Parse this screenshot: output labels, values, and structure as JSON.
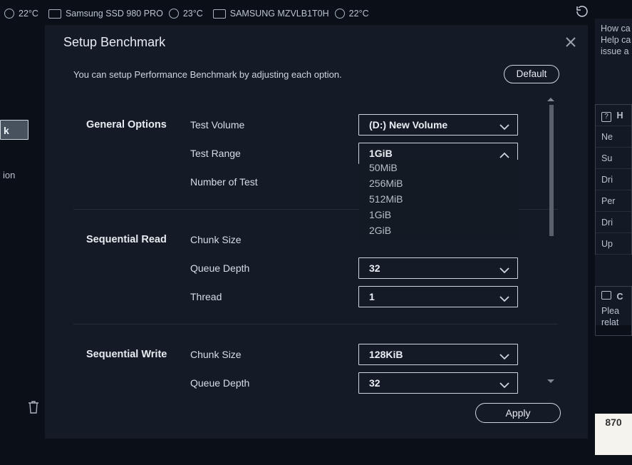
{
  "topbar": {
    "temp1": "22°C",
    "drive1": "Samsung SSD 980 PRO",
    "temp2": "23°C",
    "drive2": "SAMSUNG MZVLB1T0H",
    "temp3": "22°C"
  },
  "right": {
    "l1": "How ca",
    "l2": "Help ca",
    "l3": "issue a",
    "panel_head_icon": "?",
    "panel_head": "H",
    "items": [
      "Ne",
      "Su",
      "Dri",
      "Per",
      "Dri",
      "Up"
    ],
    "panel2_icon": "C",
    "panel2_l1": "Plea",
    "panel2_l2": "relat"
  },
  "left": {
    "sel": "k",
    "ion": "ion"
  },
  "blurb": "870 ",
  "modal": {
    "title": "Setup Benchmark",
    "subtitle": "You can setup Performance Benchmark by adjusting each option.",
    "default_btn": "Default",
    "apply_btn": "Apply",
    "sections": {
      "general": {
        "label": "General Options",
        "rows": {
          "test_volume": {
            "label": "Test Volume",
            "value": "(D:) New Volume"
          },
          "test_range": {
            "label": "Test Range",
            "value": "1GiB",
            "options": [
              "50MiB",
              "256MiB",
              "512MiB",
              "1GiB",
              "2GiB"
            ]
          },
          "num_test": {
            "label": "Number of Test"
          }
        }
      },
      "seq_read": {
        "label": "Sequential Read",
        "rows": {
          "chunk": {
            "label": "Chunk Size"
          },
          "queue": {
            "label": "Queue Depth",
            "value": "32"
          },
          "thread": {
            "label": "Thread",
            "value": "1"
          }
        }
      },
      "seq_write": {
        "label": "Sequential Write",
        "rows": {
          "chunk": {
            "label": "Chunk Size",
            "value": "128KiB"
          },
          "queue": {
            "label": "Queue Depth",
            "value": "32"
          }
        }
      }
    }
  }
}
